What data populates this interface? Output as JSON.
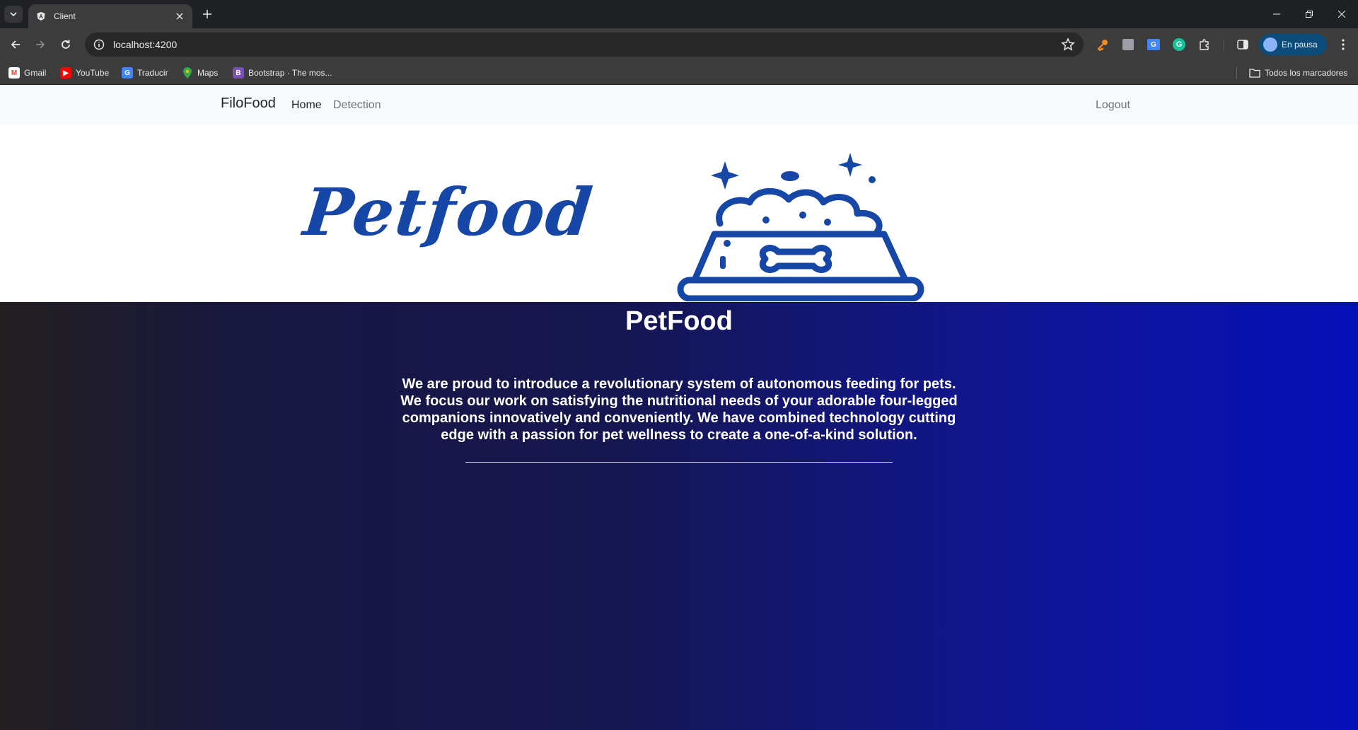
{
  "browser": {
    "tab": {
      "title": "Client"
    },
    "omnibox": {
      "url": "localhost:4200"
    },
    "profile": {
      "label": "En pausa"
    },
    "bookmarks": [
      {
        "label": "Gmail",
        "icon": "gmail-icon",
        "color": "#ea4335"
      },
      {
        "label": "YouTube",
        "icon": "youtube-icon",
        "color": "#ff0000"
      },
      {
        "label": "Traducir",
        "icon": "translate-icon",
        "color": "#4285f4"
      },
      {
        "label": "Maps",
        "icon": "maps-icon",
        "color": "#34a853"
      },
      {
        "label": "Bootstrap · The mos...",
        "icon": "bootstrap-icon",
        "color": "#7952b3"
      }
    ],
    "bookmarks_folder": {
      "label": "Todos los marcadores"
    }
  },
  "page": {
    "navbar": {
      "brand": "FiloFood",
      "links": {
        "home": "Home",
        "detection": "Detection",
        "logout": "Logout"
      }
    },
    "logo": {
      "text": "Petfood",
      "color": "#1646a6"
    },
    "hero": {
      "title": "PetFood",
      "text": "We are proud to introduce a revolutionary system of autonomous feeding for pets. We focus our work on satisfying the nutritional needs of your adorable four-legged companions innovatively and conveniently. We have combined technology cutting edge with a passion for pet wellness to create a one-of-a-kind solution."
    }
  }
}
